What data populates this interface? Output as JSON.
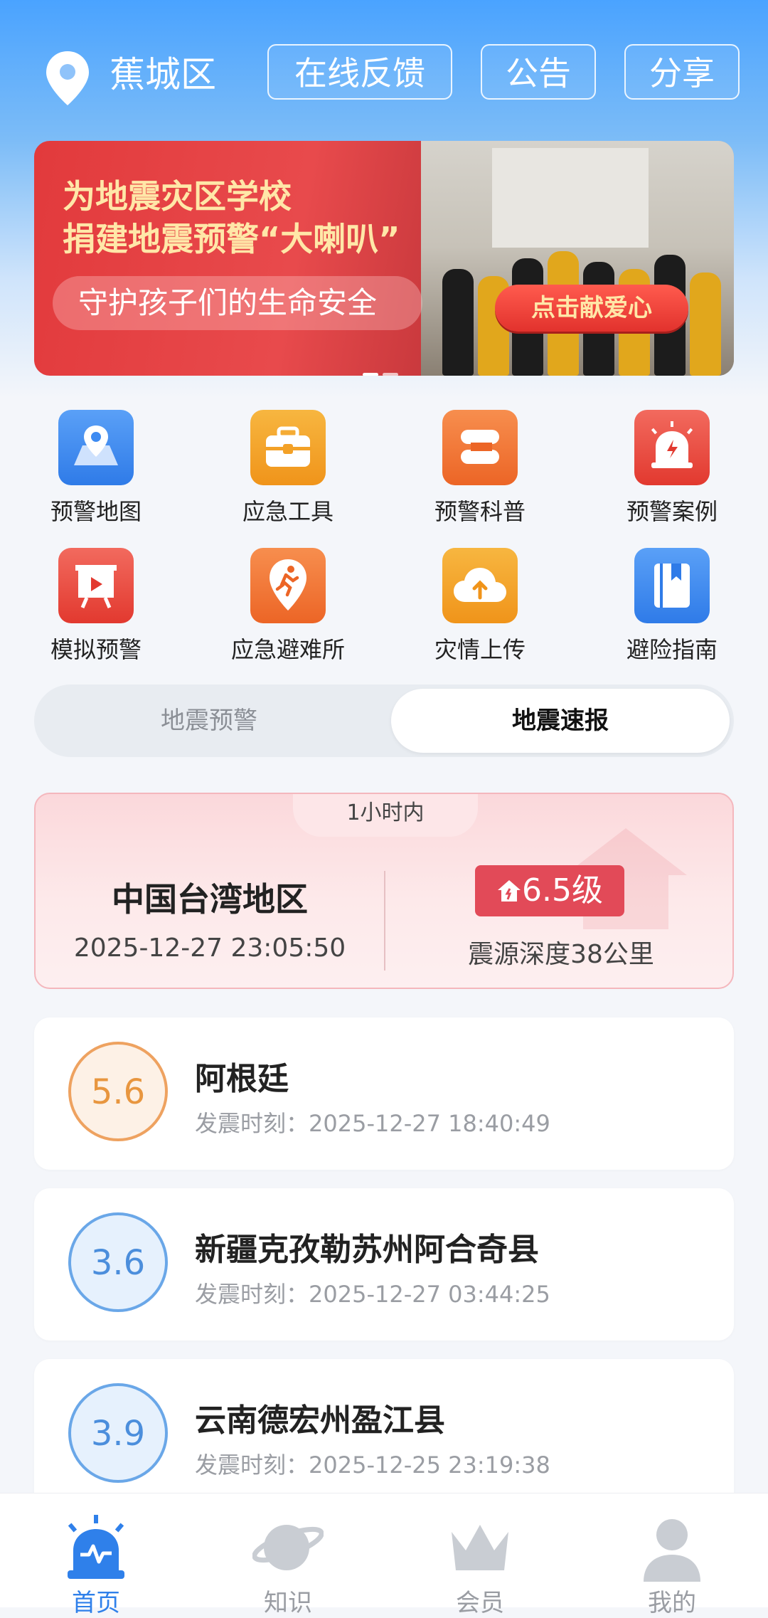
{
  "header": {
    "location": "蕉城区",
    "buttons": [
      "在线反馈",
      "公告",
      "分享"
    ]
  },
  "banner": {
    "title_line1": "为地震灾区学校",
    "title_line2": "捐建地震预警“大喇叭”",
    "subtitle": "守护孩子们的生命安全",
    "cta": "点击献爱心"
  },
  "grid": [
    {
      "label": "预警地图",
      "icon": "map-pin-icon",
      "color": "#3d8bf2"
    },
    {
      "label": "应急工具",
      "icon": "toolbox-icon",
      "color": "#f3a127"
    },
    {
      "label": "预警科普",
      "icon": "book-icon",
      "color": "#f07a3a"
    },
    {
      "label": "预警案例",
      "icon": "alarm-icon",
      "color": "#ec4c42"
    },
    {
      "label": "模拟预警",
      "icon": "video-screen-icon",
      "color": "#ec4c42"
    },
    {
      "label": "应急避难所",
      "icon": "running-person-icon",
      "color": "#f07a3a"
    },
    {
      "label": "灾情上传",
      "icon": "cloud-upload-icon",
      "color": "#f3a127"
    },
    {
      "label": "避险指南",
      "icon": "guide-book-icon",
      "color": "#3d8bf2"
    }
  ],
  "segment": {
    "options": [
      "地震预警",
      "地震速报"
    ],
    "selected": "地震速报"
  },
  "featured": {
    "tab": "1小时内",
    "region": "中国台湾地区",
    "time": "2025-12-27 23:05:50",
    "magnitude": "6.5级",
    "depth": "震源深度38公里"
  },
  "quakes": [
    {
      "mag": "5.6",
      "place": "阿根廷",
      "time_label": "发震时刻：",
      "time": "2025-12-27 18:40:49",
      "level": "orange"
    },
    {
      "mag": "3.6",
      "place": "新疆克孜勒苏州阿合奇县",
      "time_label": "发震时刻：",
      "time": "2025-12-27 03:44:25",
      "level": "blue"
    },
    {
      "mag": "3.9",
      "place": "云南德宏州盈江县",
      "time_label": "发震时刻：",
      "time": "2025-12-25 23:19:38",
      "level": "blue"
    }
  ],
  "nav": [
    {
      "label": "首页",
      "icon": "alarm-home-icon",
      "active": true
    },
    {
      "label": "知识",
      "icon": "planet-icon",
      "active": false
    },
    {
      "label": "会员",
      "icon": "crown-icon",
      "active": false
    },
    {
      "label": "我的",
      "icon": "user-icon",
      "active": false
    }
  ],
  "colors": {
    "accent": "#3d8bf2",
    "alert": "#e24a58"
  }
}
